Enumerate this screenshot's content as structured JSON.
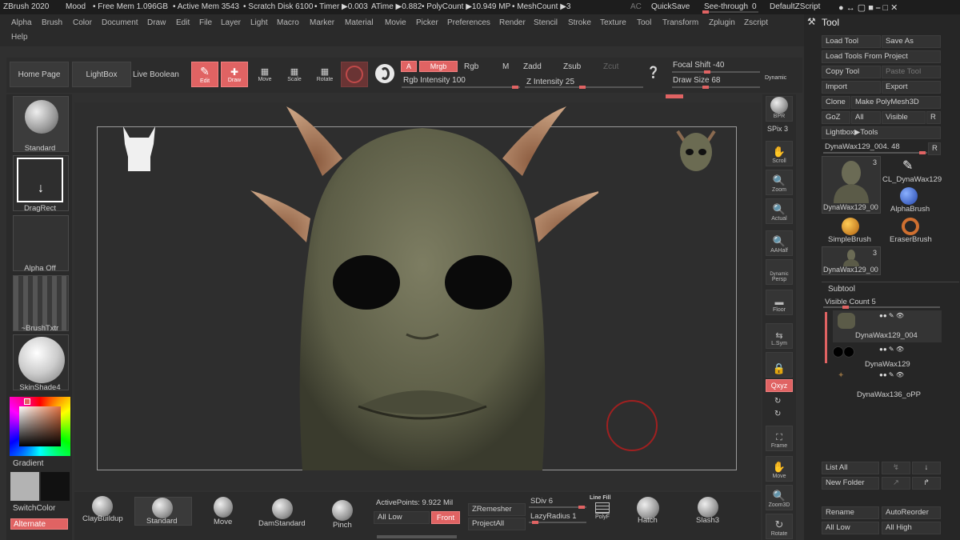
{
  "titlebar": {
    "app": "ZBrush 2020",
    "mood": "Mood",
    "free_mem": "• Free Mem 1.096GB",
    "active_mem": "• Active Mem 3543",
    "scratch": "• Scratch Disk 6100",
    "timer": "• Timer ▶0.003",
    "atime": "ATime ▶0.882",
    "polycount": "• PolyCount ▶10.949 MP",
    "meshcount": "• MeshCount ▶3",
    "ac": "AC",
    "quicksave": "QuickSave",
    "seethrough": "See-through",
    "seethrough_val": "0",
    "script": "DefaultZScript"
  },
  "menu": [
    "Alpha",
    "Brush",
    "Color",
    "Document",
    "Draw",
    "Edit",
    "File",
    "Layer",
    "Light",
    "Macro",
    "Marker",
    "Material",
    "Movie",
    "Picker",
    "Preferences",
    "Render",
    "Stencil",
    "Stroke",
    "Texture",
    "Tool",
    "Transform",
    "Zplugin",
    "Zscript"
  ],
  "menu_help": "Help",
  "topshelf": {
    "home": "Home Page",
    "lightbox": "LightBox",
    "live_boolean": "Live Boolean",
    "edit": "Edit",
    "draw": "Draw",
    "move": "Move",
    "scale": "Scale",
    "rotate": "Rotate",
    "a": "A",
    "mrgb": "Mrgb",
    "rgb": "Rgb",
    "m": "M",
    "rgb_intensity": "Rgb Intensity 100",
    "zadd": "Zadd",
    "zsub": "Zsub",
    "zcut": "Zcut",
    "z_intensity": "Z Intensity 25",
    "focal_shift": "Focal Shift -40",
    "draw_size": "Draw Size 68",
    "dynamic": "Dynamic"
  },
  "leftshelf": {
    "standard": "Standard",
    "dragrect": "DragRect",
    "alpha_off": "Alpha Off",
    "brushtxtr": "~BrushTxtr",
    "skinshade": "SkinShade4",
    "gradient": "Gradient",
    "switchcolor": "SwitchColor",
    "alternate": "Alternate"
  },
  "rightshelf": {
    "bpr": "BPR",
    "spix": "SPix 3",
    "scroll": "Scroll",
    "zoom": "Zoom",
    "actual": "Actual",
    "aahalf": "AAHalf",
    "dynamic": "Dynamic",
    "persp": "Persp",
    "floor": "Floor",
    "lsym": "L.Sym",
    "xyz": "Qxyz",
    "frame": "Frame",
    "move": "Move",
    "zoom3d": "Zoom3D",
    "rotate": "Rotate"
  },
  "toolpanel": {
    "title": "Tool",
    "load_tool": "Load Tool",
    "save_as": "Save As",
    "load_from_project": "Load Tools From Project",
    "copy_tool": "Copy Tool",
    "paste_tool": "Paste Tool",
    "import": "Import",
    "export": "Export",
    "clone": "Clone",
    "make_polymesh": "Make PolyMesh3D",
    "goz": "GoZ",
    "all": "All",
    "visible": "Visible",
    "r": "R",
    "lightbox_tools": "Lightbox▶Tools",
    "current_tool": "DynaWax129_004. 48",
    "tools": [
      {
        "name": "DynaWax129_00",
        "count": "3"
      },
      {
        "name": "CL_DynaWax129",
        "count": ""
      },
      {
        "name": "AlphaBrush",
        "count": ""
      },
      {
        "name": "SimpleBrush",
        "count": ""
      },
      {
        "name": "EraserBrush",
        "count": ""
      },
      {
        "name": "DynaWax129_00",
        "count": "3"
      }
    ],
    "subtool": "Subtool",
    "visible_count": "Visible Count 5",
    "subtools": [
      "DynaWax129_004",
      "DynaWax129",
      "DynaWax136_oPP"
    ],
    "list_all": "List All",
    "new_folder": "New Folder",
    "rename": "Rename",
    "autoreorder": "AutoReorder",
    "all_low": "All Low",
    "all_high": "All High"
  },
  "bottomshelf": {
    "claybuildup": "ClayBuildup",
    "standard": "Standard",
    "move": "Move",
    "damstandard": "DamStandard",
    "pinch": "Pinch",
    "active_points": "ActivePoints: 9.922 Mil",
    "all_low": "All Low",
    "front": "Front",
    "zremesher": "ZRemesher",
    "projectall": "ProjectAll",
    "sdiv": "SDiv 6",
    "lazyradius": "LazyRadius 1",
    "linefill": "Line Fill",
    "polyf": "PolyF",
    "hatch": "Hatch",
    "slash3": "Slash3"
  },
  "colors": {
    "accent": "#e06363",
    "panel": "#2a2a2a",
    "viewport": "#2e2e2e"
  }
}
